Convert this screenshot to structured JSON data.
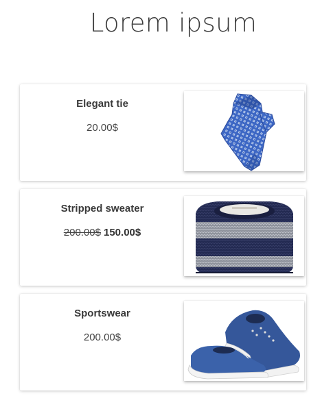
{
  "page": {
    "title": "Lorem ipsum"
  },
  "products": [
    {
      "name": "Elegant tie",
      "price": "20.00$",
      "image_icon": "tie-image"
    },
    {
      "name": "Stripped sweater",
      "old_price": "200.00$",
      "new_price": "150.00$",
      "image_icon": "sweater-image"
    },
    {
      "name": "Sportswear",
      "price": "200.00$",
      "image_icon": "sneakers-image"
    }
  ],
  "colors": {
    "tie_blue": "#3d67c4",
    "sweater_navy": "#232a52",
    "sweater_grey": "#8e929c",
    "shoe_blue": "#35579a"
  }
}
